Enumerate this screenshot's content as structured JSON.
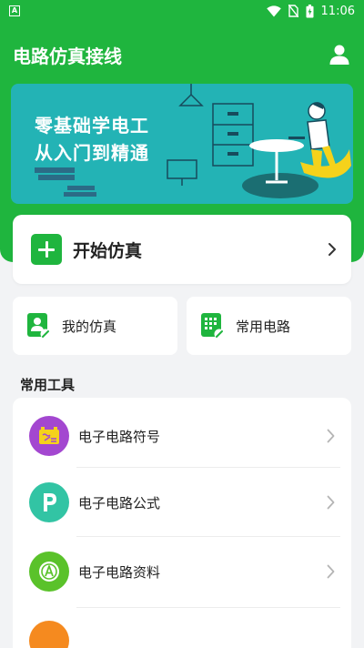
{
  "status_bar": {
    "time": "11:06",
    "left_icon": "a-notification-icon",
    "icons": [
      "wifi-icon",
      "no-sim-icon",
      "battery-charging-icon"
    ]
  },
  "header": {
    "title": "电路仿真接线",
    "user_icon": "user-icon"
  },
  "banner": {
    "line1": "零基础学电工",
    "line2": "从入门到精通"
  },
  "start": {
    "label": "开始仿真"
  },
  "tiles": [
    {
      "label": "我的仿真",
      "icon": "my-simulation-icon"
    },
    {
      "label": "常用电路",
      "icon": "common-circuit-icon"
    }
  ],
  "tools": {
    "title": "常用工具",
    "items": [
      {
        "label": "电子电路符号",
        "icon": "circuit-symbol-icon",
        "color": "#a347d0"
      },
      {
        "label": "电子电路公式",
        "icon": "formula-p-icon",
        "color": "#32c4a4"
      },
      {
        "label": "电子电路资料",
        "icon": "document-a-icon",
        "color": "#5ac22a"
      },
      {
        "label": "",
        "icon": "orange-tool-icon",
        "color": "#f58a1f"
      }
    ]
  },
  "colors": {
    "brand_green": "#1fb53e",
    "banner_teal": "#23b3b5",
    "page_bg": "#f2f3f5"
  }
}
